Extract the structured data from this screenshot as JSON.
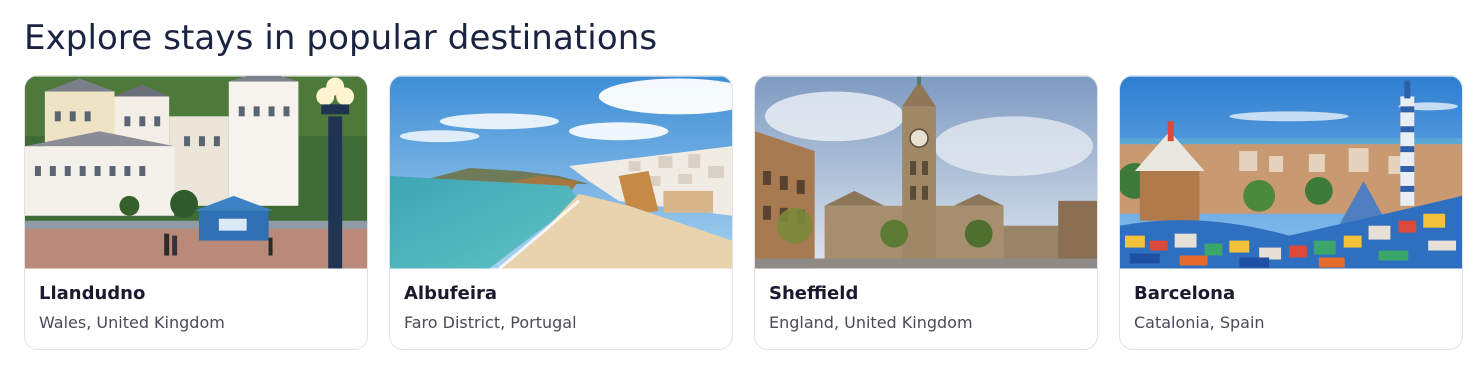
{
  "section": {
    "title": "Explore stays in popular destinations"
  },
  "destinations": [
    {
      "city": "Llandudno",
      "region": "Wales, United Kingdom"
    },
    {
      "city": "Albufeira",
      "region": "Faro District, Portugal"
    },
    {
      "city": "Sheffield",
      "region": "England, United Kingdom"
    },
    {
      "city": "Barcelona",
      "region": "Catalonia, Spain"
    }
  ]
}
